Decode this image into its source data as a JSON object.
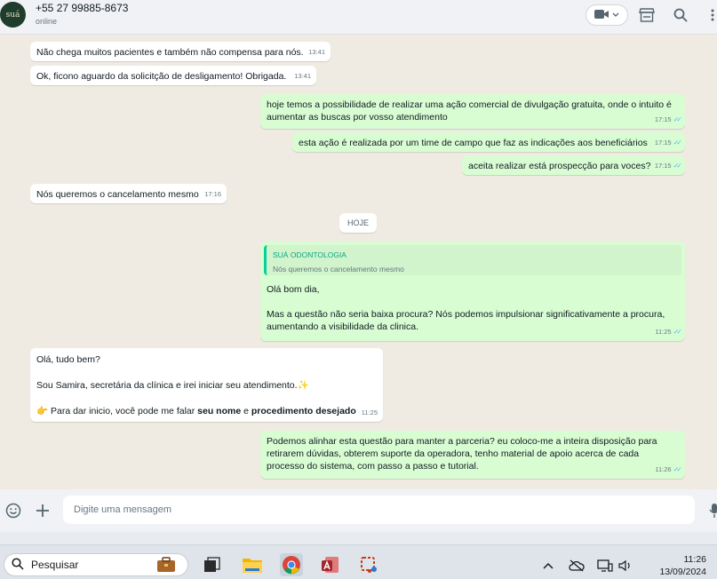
{
  "header": {
    "avatar_text": "suá",
    "contact_name": "+55 27 99885-8673",
    "status": "online",
    "icons": [
      "video-call-icon",
      "chevron-down-icon",
      "store-icon",
      "search-icon",
      "menu-icon"
    ]
  },
  "messages": [
    {
      "dir": "in",
      "text": "Não chega muitos pacientes e também não compensa para nós.",
      "time": "13:41"
    },
    {
      "dir": "in",
      "text": "Ok, ficono aguardo da solicitção de desligamento! Obrigada.",
      "time": "13:41"
    },
    {
      "dir": "out",
      "text": "hoje temos a possibilidade de realizar uma ação comercial de divulgação gratuita, onde o intuito é aumentar as buscas por vosso atendimento",
      "time": "17:15"
    },
    {
      "dir": "out",
      "text": "esta ação é realizada por um time de campo que faz as indicações aos beneficiários",
      "time": "17:15"
    },
    {
      "dir": "out",
      "text": "aceita realizar está prospecção para voces?",
      "time": "17:15"
    },
    {
      "dir": "in",
      "text": "Nós queremos o cancelamento mesmo",
      "time": "17:16"
    },
    {
      "dir": "day",
      "text": "HOJE"
    },
    {
      "dir": "out",
      "quote_author": "SUÁ ODONTOLOGIA",
      "quote_text": "Nós queremos o cancelamento mesmo",
      "text": "Olá bom dia,\n\nMas a questão não seria baixa procura? Nós podemos impulsionar significativamente a procura, aumentando a visibilidade da clinica.",
      "time": "11:25"
    },
    {
      "dir": "in",
      "line1": "Olá, tudo bem?",
      "line2": "Sou Samira, secretária da clínica e irei iniciar seu atendimento.✨",
      "line3_prefix": "👉 Para dar inicio, você pode me falar ",
      "bold1": "seu nome",
      "mid": " e ",
      "bold2": "procedimento desejado",
      "time": "11:25"
    },
    {
      "dir": "out",
      "text": "Podemos alinhar esta questão para manter a parceria? eu coloco-me a inteira disposição para retirarem dúvidas, obterem suporte da operadora, tenho material de apoio acerca de cada processo do sistema, com passo a passo e tutorial.",
      "time": "11:26"
    }
  ],
  "composer": {
    "placeholder": "Digite uma mensagem",
    "icons": [
      "emoji-icon",
      "plus-icon",
      "microphone-icon"
    ]
  },
  "taskbar": {
    "search_label": "Pesquisar",
    "apps": [
      "work-bag-icon",
      "task-view-icon",
      "file-explorer-icon",
      "chrome-icon",
      "access-icon",
      "snipping-tool-icon"
    ],
    "time": "11:26",
    "date": "13/09/2024"
  },
  "colors": {
    "incoming": "#ffffff",
    "outgoing": "#d9fdd3",
    "read_tick": "#53bdeb",
    "accent": "#06cf9c"
  }
}
